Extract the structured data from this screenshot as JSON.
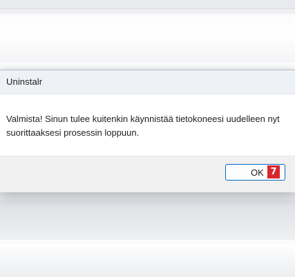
{
  "dialog": {
    "title": "Uninstalr",
    "message": "Valmista! Sinun tulee kuitenkin käynnistää tietokoneesi uudelleen nyt suorittaaksesi prosessin loppuun.",
    "ok_label": "OK",
    "step_badge": "7"
  },
  "colors": {
    "accent": "#0067c0",
    "badge": "#d8262e",
    "titlebar": "#eef2f7",
    "button_bar": "#f0f0f0"
  }
}
